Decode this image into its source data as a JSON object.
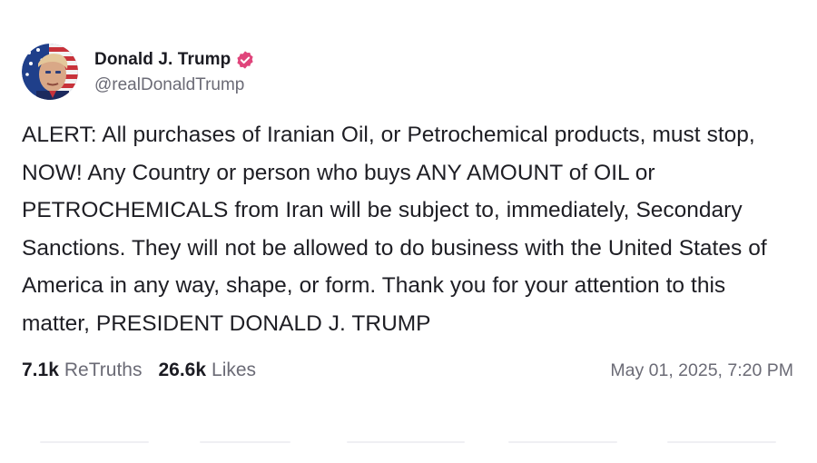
{
  "post": {
    "author": {
      "display_name": "Donald J. Trump",
      "handle": "@realDonaldTrump",
      "verified": true,
      "verified_color": "#e0457b"
    },
    "text": "ALERT: All purchases of Iranian Oil, or Petrochemical products, must stop, NOW! Any Country or person who buys ANY AMOUNT of OIL or PETROCHEMICALS from Iran will be subject to, immediately, Secondary Sanctions. They will not be allowed to do business with the United States of America in any way, shape, or form. Thank you for your attention to this matter, PRESIDENT DONALD J. TRUMP",
    "stats": {
      "retruths_count": "7.1k",
      "retruths_label": "ReTruths",
      "likes_count": "26.6k",
      "likes_label": "Likes"
    },
    "timestamp": "May 01, 2025, 7:20 PM"
  },
  "icons": {
    "verified": "verified-badge-icon",
    "avatar": "profile-avatar"
  },
  "colors": {
    "text_primary": "#1e1e24",
    "text_secondary": "#6b6b76",
    "background": "#ffffff"
  }
}
